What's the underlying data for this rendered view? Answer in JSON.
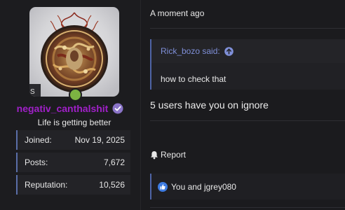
{
  "user": {
    "username": "negativ_canthalshit",
    "title": "Life is getting better",
    "stats": [
      {
        "label": "Joined:",
        "value": "Nov 19, 2025"
      },
      {
        "label": "Posts:",
        "value": "7,672"
      },
      {
        "label": "Reputation:",
        "value": "10,526"
      }
    ],
    "avatar_icon": "ornate-dragon-avatar",
    "online_status_color": "#7cb342",
    "username_color": "#a020c8",
    "verified_icon": "verified-check-icon"
  },
  "post": {
    "timestamp": "A moment ago",
    "quote": {
      "author_said": "Rick_bozo said:",
      "text": "how to check that"
    },
    "message": "5 users have you on ignore",
    "report_label": "Report",
    "likes_text": "You and jgrey080"
  },
  "colors": {
    "background": "#1b1b1e",
    "accent_blue": "#4f64a6",
    "quote_link": "#7f8fd8"
  }
}
